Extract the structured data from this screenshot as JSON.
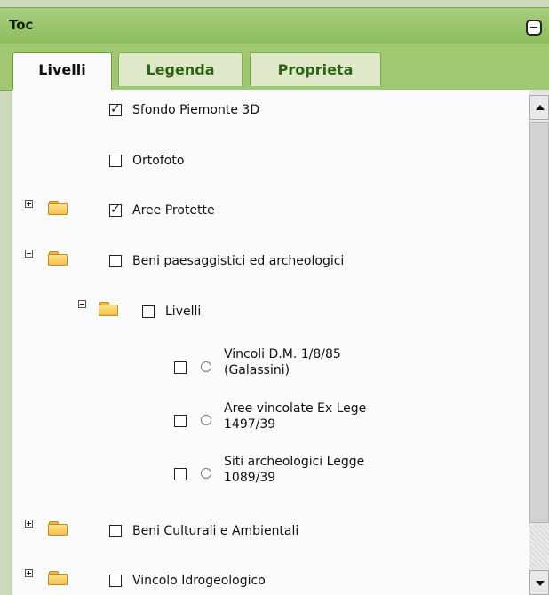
{
  "panel": {
    "title": "Toc",
    "collapse_icon": "collapse-minus-icon",
    "colors": {
      "header_green": "#8fbd5c",
      "tab_text_green": "#2e6215",
      "content_bg": "#fbfbfb"
    }
  },
  "tabs": [
    {
      "label": "Livelli",
      "active": true
    },
    {
      "label": "Legenda",
      "active": false
    },
    {
      "label": "Proprieta",
      "active": false
    }
  ],
  "layers": [
    {
      "label": "Sfondo Piemonte 3D",
      "checked": true
    },
    {
      "label": "Ortofoto",
      "checked": false
    },
    {
      "label": "Aree Protette",
      "checked": true,
      "expander": "plus"
    },
    {
      "label": "Beni paesaggistici ed archeologici",
      "checked": false,
      "expander": "minus"
    },
    {
      "label": "Livelli",
      "checked": false,
      "expander": "minus"
    },
    {
      "label_line1": "Vincoli D.M. 1/8/85",
      "label_line2": "(Galassini)",
      "checked": false
    },
    {
      "label_line1": "Aree vincolate Ex Lege",
      "label_line2": "1497/39",
      "checked": false
    },
    {
      "label_line1": "Siti archeologici Legge",
      "label_line2": "1089/39",
      "checked": false
    },
    {
      "label": "Beni Culturali e Ambientali",
      "checked": false,
      "expander": "plus"
    },
    {
      "label": "Vincolo Idrogeologico",
      "checked": false,
      "expander": "plus"
    }
  ]
}
